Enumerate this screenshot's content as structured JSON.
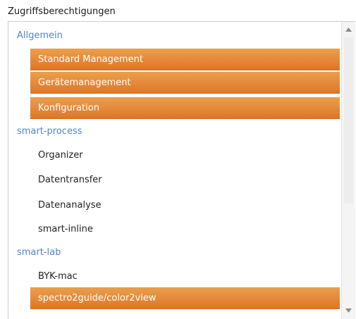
{
  "panel": {
    "title": "Zugriffsberechtigungen"
  },
  "groups": [
    {
      "header": "Allgemein",
      "items": [
        {
          "label": "Standard Management",
          "selected": true
        },
        {
          "label": "Gerätemanagement",
          "selected": true
        },
        {
          "label": "Konfiguration",
          "selected": true
        }
      ]
    },
    {
      "header": "smart-process",
      "items": [
        {
          "label": "Organizer",
          "selected": false
        },
        {
          "label": "Datentransfer",
          "selected": false
        },
        {
          "label": "Datenanalyse",
          "selected": false
        },
        {
          "label": "smart-inline",
          "selected": false
        }
      ]
    },
    {
      "header": "smart-lab",
      "items": [
        {
          "label": "BYK-mac",
          "selected": false
        },
        {
          "label": "spectro2guide/color2view",
          "selected": true
        }
      ]
    }
  ],
  "scrollbar": {
    "up_icon": "triangle-up-icon",
    "down_icon": "triangle-down-icon"
  },
  "colors": {
    "group_header": "#4e87c4",
    "selection": "#e5883a",
    "selection_text": "#ffffff",
    "item_text": "#1f1f1f"
  }
}
